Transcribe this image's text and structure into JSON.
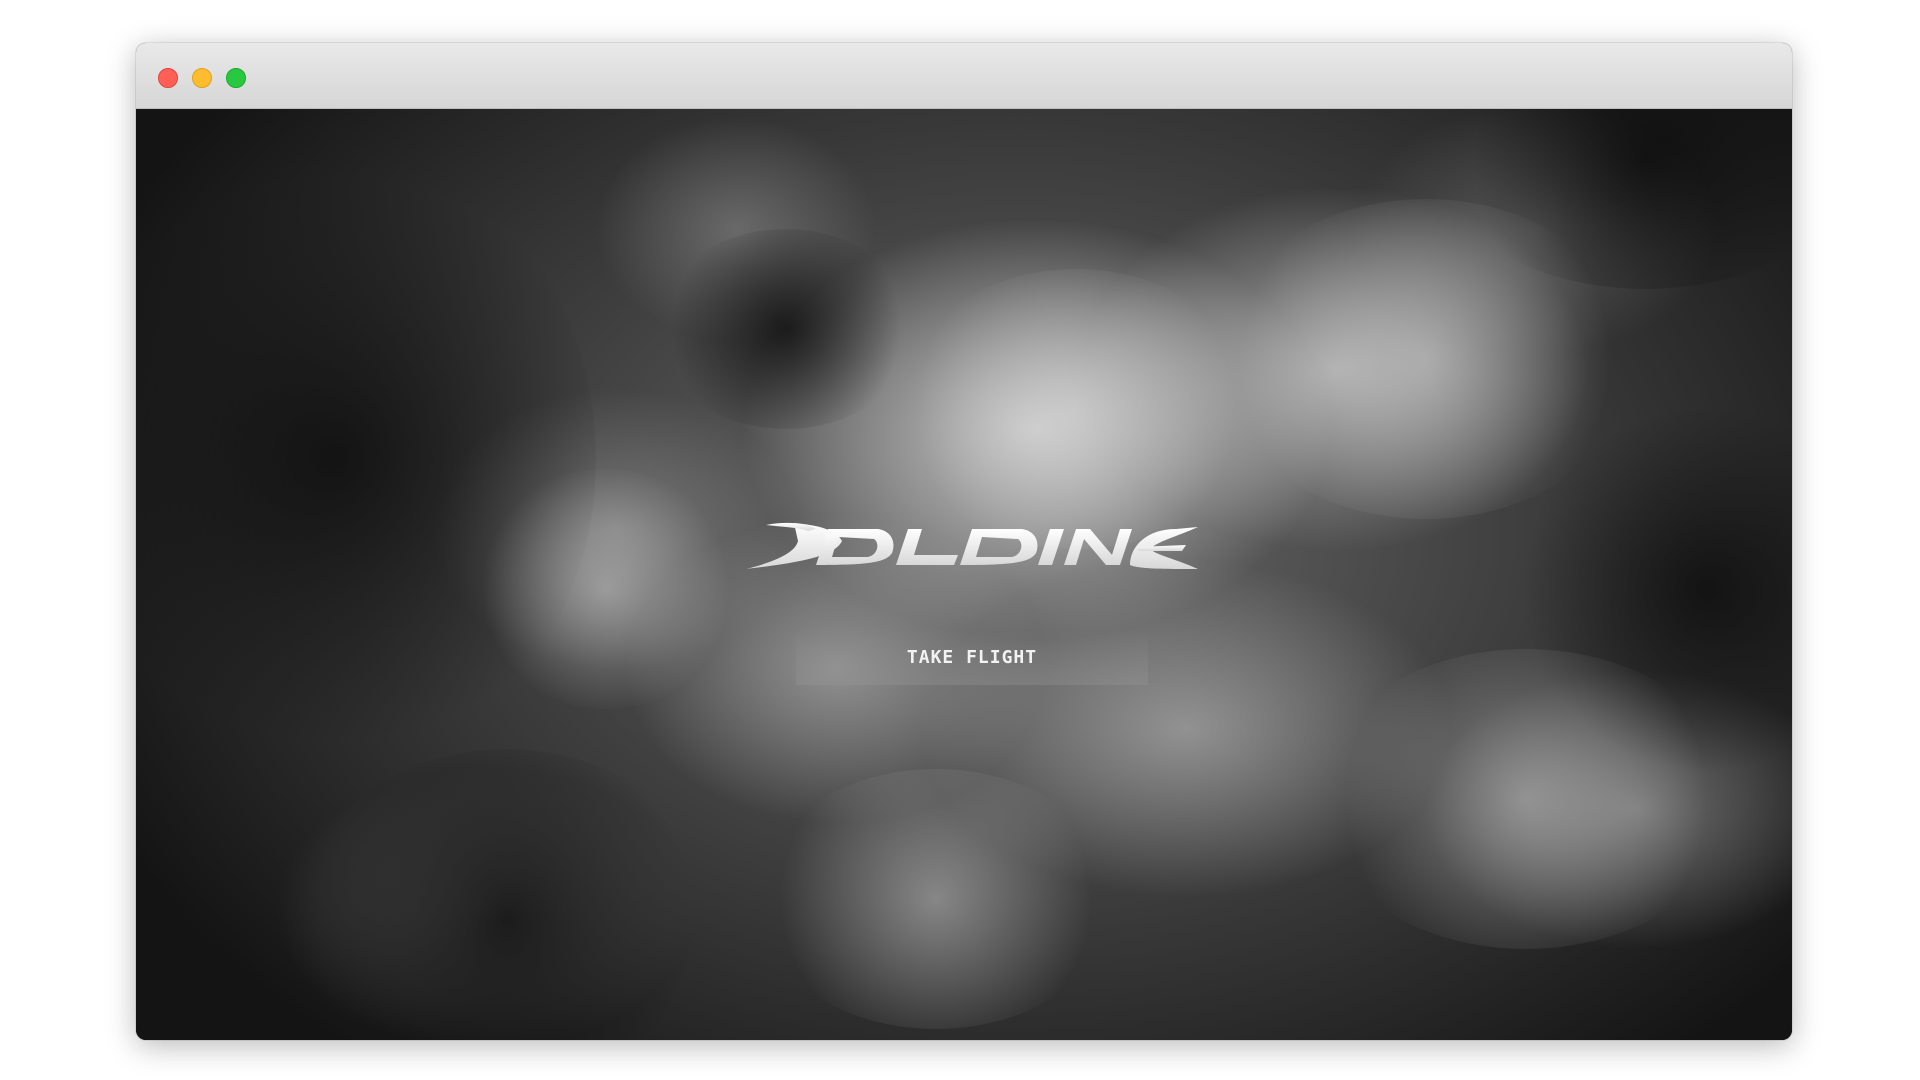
{
  "window": {
    "controls": [
      "close",
      "minimize",
      "maximize"
    ],
    "colors": {
      "close": "#fe5f57",
      "minimize": "#febc2e",
      "maximize": "#28c840"
    }
  },
  "hero": {
    "background": "storm-clouds-grayscale",
    "logo_icon": "stylized-wordmark-logo",
    "cta_label": "TAKE FLIGHT"
  }
}
